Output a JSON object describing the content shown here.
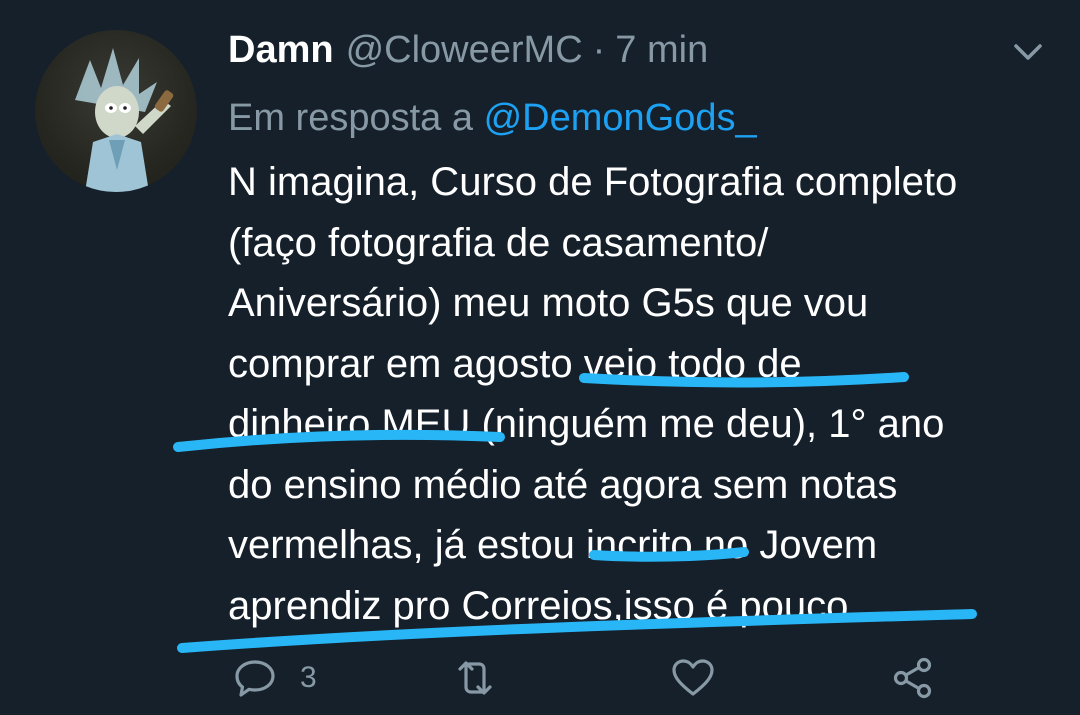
{
  "tweet": {
    "display_name": "Damn",
    "handle": "@CloweerMC",
    "separator": "·",
    "time": "7 min",
    "reply_prefix": "Em resposta a",
    "reply_to": "@DemonGods_",
    "body_lines": [
      "N imagina, Curso de Fotografia completo",
      "(faço fotografia de casamento/",
      "Aniversário) meu moto G5s que vou",
      "comprar em agosto veio todo de",
      "dinheiro MEU (ninguém me deu), 1° ano",
      "do ensino médio até agora sem notas",
      "vermelhas, já estou incrito no Jovem",
      "aprendiz pro Correios,isso é pouco"
    ],
    "reply_count": "3"
  },
  "colors": {
    "background": "#15202b",
    "text": "#ffffff",
    "muted": "#8899a6",
    "link": "#1da1f2",
    "highlight": "#29b6f6"
  },
  "icons": {
    "avatar": "rick-cartoon-avatar",
    "more": "chevron-down-icon",
    "reply": "reply-icon",
    "retweet": "retweet-icon",
    "like": "heart-icon",
    "share": "share-icon"
  }
}
